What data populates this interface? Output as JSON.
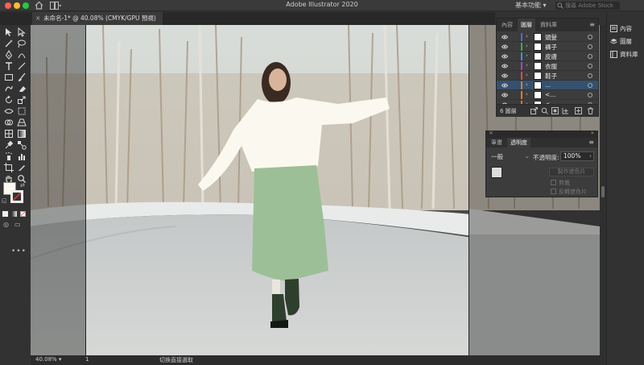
{
  "app": {
    "title": "Adobe Illustrator 2020",
    "workspace": "基本功能 ▾",
    "search_placeholder": "搜尋 Adobe Stock"
  },
  "document": {
    "tab_title": "未命名-1* @ 40.08% (CMYK/GPU 預視)",
    "close": "×"
  },
  "status": {
    "zoom": "40.08% ▾",
    "artboard": "1",
    "text": "切換直接選取"
  },
  "layers_panel": {
    "tabs": [
      "內容",
      "圖層",
      "資料庫"
    ],
    "active_tab": "圖層",
    "layers": [
      {
        "name": "頭髮",
        "color": "#4f6bd6",
        "selected": false
      },
      {
        "name": "褲子",
        "color": "#36b04a",
        "selected": false
      },
      {
        "name": "皮膚",
        "color": "#2c9bd6",
        "selected": false
      },
      {
        "name": "衣服",
        "color": "#b43bd0",
        "selected": false
      },
      {
        "name": "鞋子",
        "color": "#e04a4a",
        "selected": false
      },
      {
        "name": "...",
        "color": "#e07a22",
        "selected": true
      },
      {
        "name": "<...",
        "color": "#e07a22",
        "selected": false
      },
      {
        "name": "<...",
        "color": "#e07a22",
        "selected": false
      }
    ],
    "count_label": "6 圖層"
  },
  "transparency_panel": {
    "tabs": [
      "筆畫",
      "透明度"
    ],
    "active_tab": "透明度",
    "blend_mode": "一般",
    "opacity_label": "不透明度:",
    "opacity_value": "100%",
    "make_mask": "製作遮色片",
    "clip": "剪裁",
    "invert_mask": "反轉遮色片"
  },
  "dock": {
    "items": [
      "內容",
      "圖層",
      "資料庫"
    ]
  },
  "colors": {
    "sweater": "#fbf9ef",
    "skirt": "#9cbf98",
    "boots": "#2f3f2e",
    "selection": "#35516f"
  }
}
